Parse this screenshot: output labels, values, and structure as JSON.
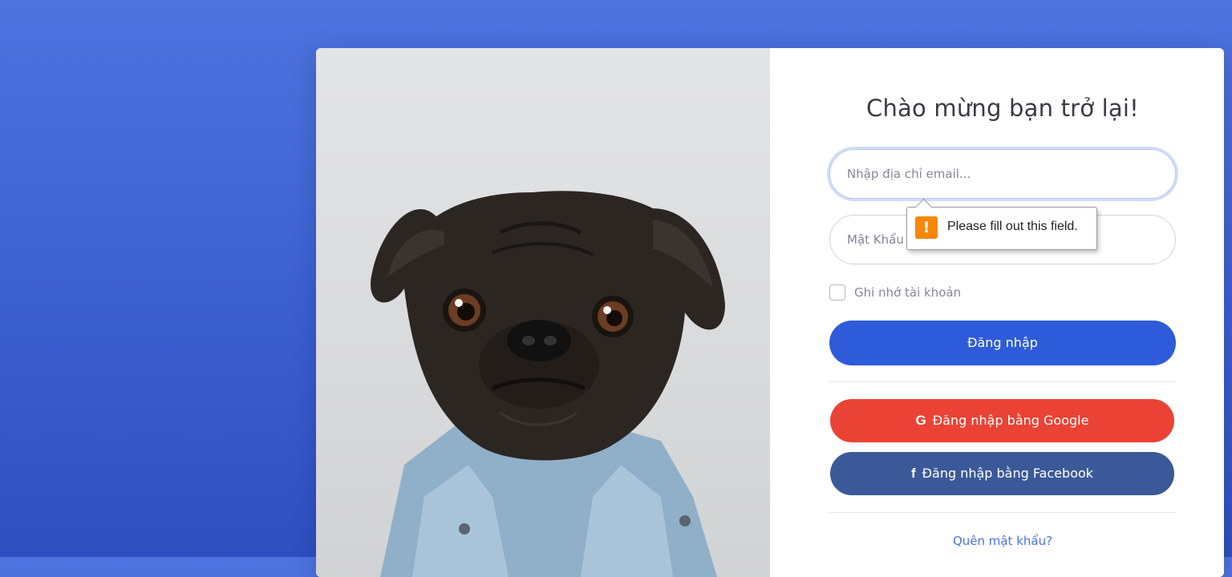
{
  "login": {
    "title": "Chào mừng bạn trở lại!",
    "email_placeholder": "Nhập địa chỉ email...",
    "password_placeholder": "Mật Khẩu",
    "remember_label": "Ghi nhớ tài khoản",
    "login_button": "Đăng nhập",
    "google_button": "Đăng nhập bằng Google",
    "facebook_button": "Đăng nhập bằng Facebook",
    "forgot_link": "Quên mật khẩu?"
  },
  "validation": {
    "message": "Please fill out this field.",
    "icon": "exclamation-warning-icon"
  },
  "colors": {
    "background": "#4e73df",
    "primary": "#2e5bd9",
    "google": "#ea4335",
    "facebook": "#3b5998",
    "link": "#4e73df",
    "warning": "#f5880a"
  }
}
